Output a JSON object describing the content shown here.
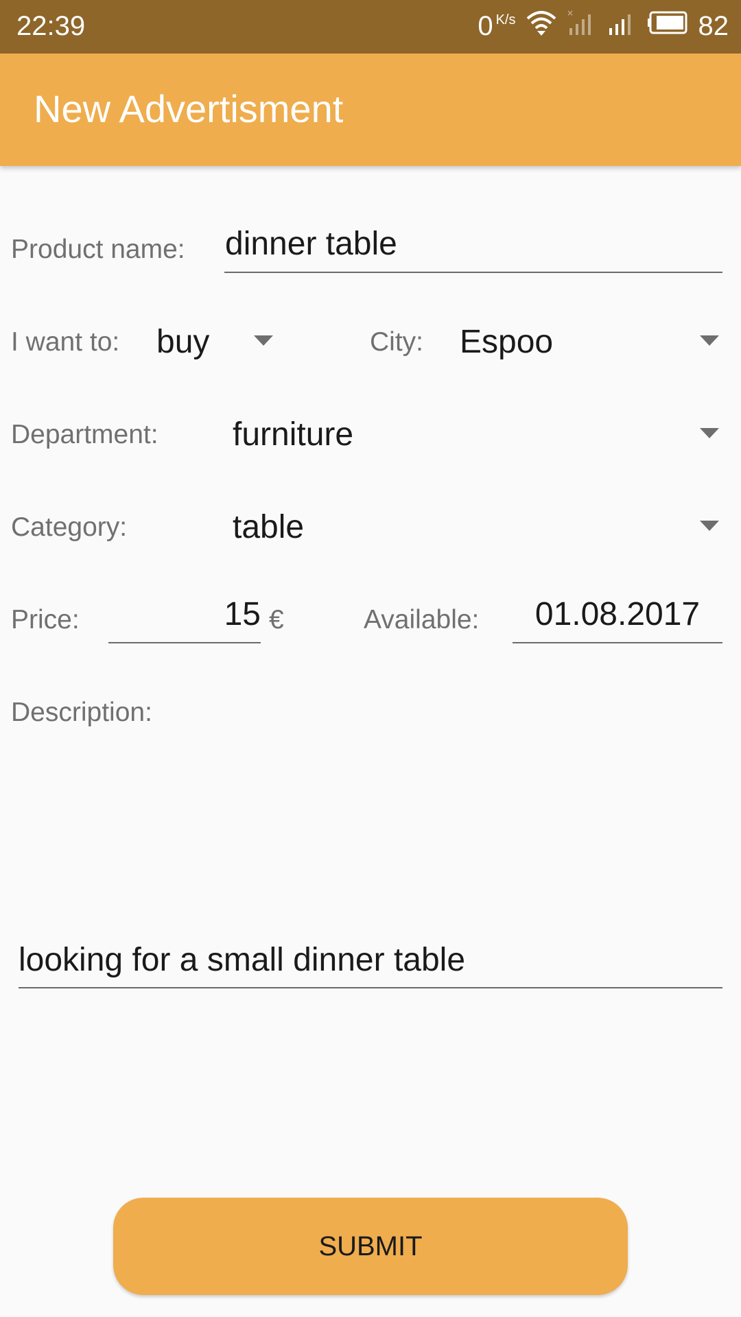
{
  "status_bar": {
    "time": "22:39",
    "net_speed_value": "0",
    "net_speed_unit": "K/s",
    "battery_level": "82",
    "icons": [
      "wifi-icon",
      "signal-sim1-icon",
      "signal-sim2-icon",
      "battery-icon"
    ]
  },
  "app_bar": {
    "title": "New Advertisment"
  },
  "form": {
    "product_name": {
      "label": "Product name:",
      "value": "dinner table"
    },
    "want_to": {
      "label": "I want to:",
      "selected": "buy"
    },
    "city": {
      "label": "City:",
      "selected": "Espoo"
    },
    "department": {
      "label": "Department:",
      "selected": "furniture"
    },
    "category": {
      "label": "Category:",
      "selected": "table"
    },
    "price": {
      "label": "Price:",
      "value": "15",
      "currency": "€"
    },
    "available": {
      "label": "Available:",
      "value": "01.08.2017"
    },
    "description": {
      "label": "Description:",
      "value": "looking for a small dinner table"
    }
  },
  "submit_button": {
    "label": "SUBMIT"
  },
  "colors": {
    "status_bar": "#8e662a",
    "accent": "#efad4e",
    "background": "#fafafa"
  }
}
